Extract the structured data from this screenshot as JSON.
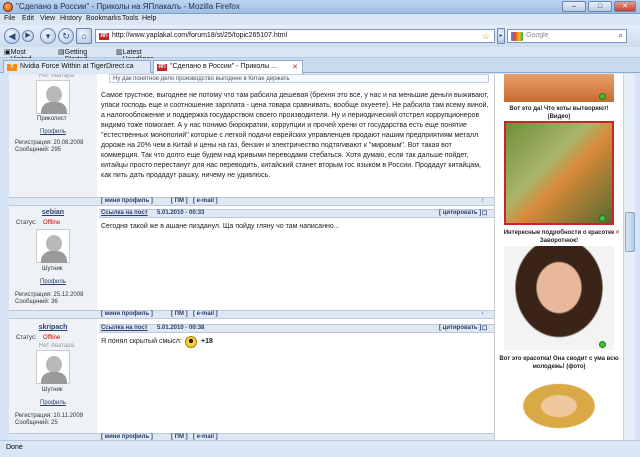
{
  "window": {
    "title": "\"Сделано в России\" - Приколы на ЯПлакалъ - Mozilla Firefox"
  },
  "menu": [
    "File",
    "Edit",
    "View",
    "History",
    "Bookmarks",
    "Tools",
    "Help"
  ],
  "nav": {
    "url": "http://www.yaplakal.com/forum18/st/25/topic265107.html",
    "search_placeholder": "Google"
  },
  "bookmarks": [
    "Most Visited",
    "Getting Started",
    "Latest Headlines"
  ],
  "tabs": [
    {
      "label": "Nvidia Force Within at TigerDirect.ca"
    },
    {
      "label": "\"Сделано в России\" - Приколы ..."
    }
  ],
  "posts": [
    {
      "quote": "Ну дак понятное дело производство выгоднее в Китае держать",
      "rank": "Приколист",
      "profile": "Профиль",
      "reg": "Регистрация: 20.08.2008",
      "msgs": "Сообщений: 295",
      "text": "Самое грустное, выгоднее не потому что там рабсила дешевая (брехня это все, у нас и на меньшие деньги выживают, упаси господь еще и соотношение зарплата - цена товара сравнивать, вообще охуеете). Не рабсила там всему виной, а налогообложение и поддержка государством своего производителя. Ну и периодический отстрел коррупционеров видимо тоже помогает. А у нас понимо бюрократии, коррупции и прочей хрени от государства есть еще понятие \"естественных монополий\" которые с легкой подачи еврейских управленцев продают нашим предприятиям металл дороже на 20% чем в Китай и цены на газ, бензин и электричество подтягивают к \"мировым\". Вот такая вот коммерция. Так что долго еще будем над кривыми переводами стебаться. Хотя думаю, если так дальше пойдет, китайцы просто перестанут для нас переводить, китайский станет вторым гос языком в России. Продадут китайцам, как пить дать продадут рашку, ничему не удивлюсь."
    },
    {
      "user": "sebian",
      "status_label": "Статус:",
      "status": "Offline",
      "rank": "Шутник",
      "profile": "Профиль",
      "reg": "Регистрация: 25.12.2008",
      "msgs": "Сообщений: 36",
      "postlink": "Ссылка на пост",
      "date": "5.01.2010 - 00:33",
      "text": "Сегодня такой же в ашане пизданул. Ща пойду гляну чо там написанно..."
    },
    {
      "user": "skripach",
      "status_label": "Статус:",
      "status": "Offline",
      "rank": "Шутник",
      "profile": "Профиль",
      "reg": "Регистрация: 10.11.2009",
      "msgs": "Сообщений: 25",
      "postlink": "Ссылка на пост",
      "date": "5.01.2010 - 00:38",
      "text": "Я понял скрытый смысл:",
      "rating": "+18"
    }
  ],
  "bar": {
    "mini": "мини профиль",
    "pm": "ПМ",
    "email": "e-mail",
    "cite": "цитировать",
    "noava": "Нет Аватара"
  },
  "sidebar": [
    {
      "caption": "Вот это да! Что коты вытворяют! (Видео)"
    },
    {
      "caption": "Интересные подробности о красотке Заворотнюк!"
    },
    {
      "caption": "Вот это красотка! Она сводит с ума всю молодежь! (фото)"
    }
  ],
  "status": "Done",
  "colors": {
    "offline": "#cc0000",
    "accent_bar": "#dfe7f3",
    "sidebar_border": "#c1272d"
  }
}
